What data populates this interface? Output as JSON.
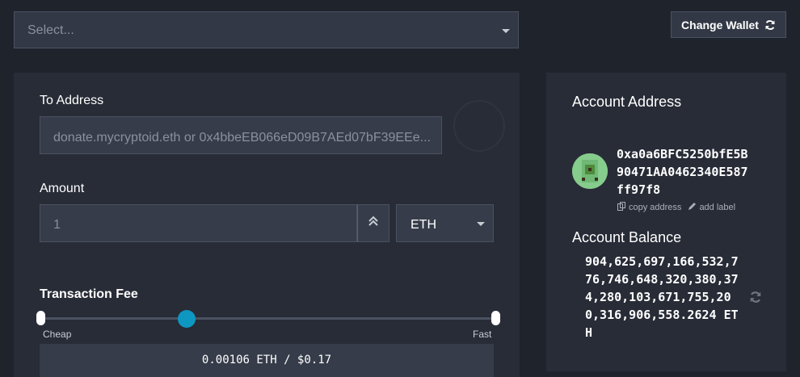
{
  "wallet_select": {
    "placeholder": "Select..."
  },
  "header": {
    "change_wallet_label": "Change Wallet"
  },
  "send_form": {
    "to_label": "To Address",
    "to_placeholder": "donate.mycryptoid.eth or 0x4bbeEB066eD09B7AEd07bF39EEe...",
    "amount_label": "Amount",
    "amount_value": "1",
    "unit": "ETH",
    "fee_label": "Transaction Fee",
    "fee_cheap_label": "Cheap",
    "fee_fast_label": "Fast",
    "fee_level": 0.32,
    "fee_display": "0.00106 ETH / $0.17"
  },
  "account": {
    "address_title": "Account Address",
    "address": "0xa0a6BFC5250bfE5B90471AA0462340E587ff97f8",
    "copy_label": "copy address",
    "add_label": "add label",
    "balance_title": "Account Balance",
    "balance": "904,625,697,166,532,776,746,648,320,380,374,280,103,671,755,200,316,906,558.2624 ETH"
  },
  "icons": {
    "refresh": "refresh-icon",
    "caret": "caret-down-icon",
    "max": "double-chevron-up-icon",
    "copy": "copy-icon",
    "pencil": "pencil-icon"
  },
  "colors": {
    "accent": "#0e97c0",
    "background": "#1f232c",
    "panel": "#282c37"
  }
}
